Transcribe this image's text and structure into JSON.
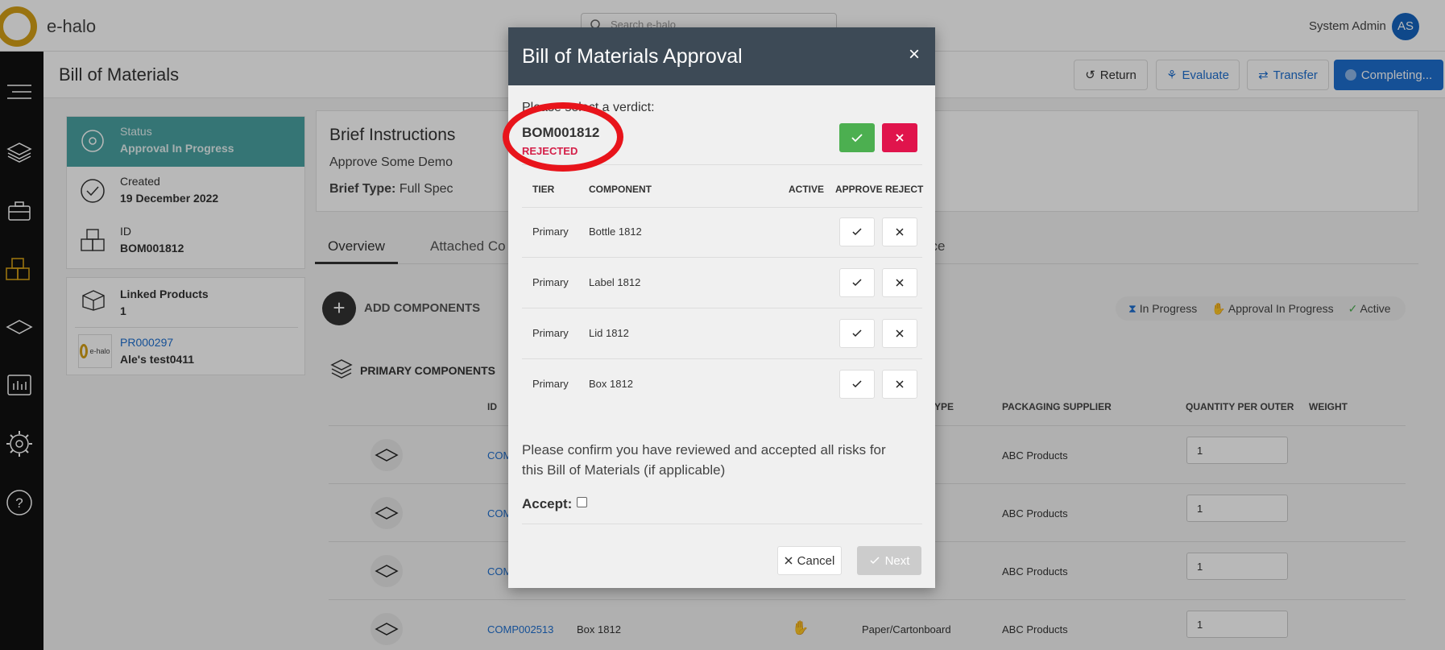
{
  "app": {
    "logo_text": "e-halo",
    "search_placeholder": "Search e-halo",
    "user_name": "System Admin",
    "user_initials": "AS"
  },
  "page": {
    "title": "Bill of Materials",
    "actions": [
      "Return",
      "Evaluate",
      "Transfer",
      "Completing..."
    ]
  },
  "info": {
    "status_label": "Status",
    "status_value": "Approval In Progress",
    "created_label": "Created",
    "created_value": "19 December 2022",
    "id_label": "ID",
    "id_value": "BOM001812",
    "linked_label": "Linked Products",
    "linked_count": "1",
    "linked_product_id": "PR000297",
    "linked_product_name": "Ale's test0411",
    "linked_logo_text": "e-halo"
  },
  "brief": {
    "title": "Brief Instructions",
    "text": "Approve Some Demo",
    "type_label": "Brief Type:",
    "type_value": "Full Spec"
  },
  "tabs": [
    "Overview",
    "Attached Co",
    "nce"
  ],
  "components": {
    "add_label": "ADD COMPONENTS",
    "section_title": "PRIMARY COMPONENTS",
    "legend": [
      "In Progress",
      "Approval In Progress",
      "Active"
    ],
    "headers": [
      "ID",
      "YPE",
      "PACKAGING SUPPLIER",
      "QUANTITY PER OUTER",
      "WEIGHT"
    ],
    "rows": [
      {
        "id": "COM",
        "name": "",
        "material": "",
        "supplier": "ABC Products",
        "qty": "1"
      },
      {
        "id": "COM",
        "name": "",
        "material": "",
        "supplier": "ABC Products",
        "qty": "1"
      },
      {
        "id": "COM",
        "name": "",
        "material": "",
        "supplier": "ABC Products",
        "qty": "1"
      },
      {
        "id": "COMP002513",
        "name": "Box 1812",
        "material": "Paper/Cartonboard",
        "supplier": "ABC Products",
        "qty": "1"
      }
    ]
  },
  "modal": {
    "title": "Bill of Materials Approval",
    "close": "×",
    "verdict_label": "Please select a verdict:",
    "bom_id": "BOM001812",
    "bom_status": "REJECTED",
    "headers": {
      "tier": "TIER",
      "component": "COMPONENT",
      "active": "ACTIVE",
      "approve": "APPROVE",
      "reject": "REJECT"
    },
    "rows": [
      {
        "tier": "Primary",
        "component": "Bottle 1812"
      },
      {
        "tier": "Primary",
        "component": "Label 1812"
      },
      {
        "tier": "Primary",
        "component": "Lid 1812"
      },
      {
        "tier": "Primary",
        "component": "Box 1812"
      }
    ],
    "confirm_text": "Please confirm you have reviewed and accepted all risks for this Bill of Materials (if applicable)",
    "accept_label": "Accept:",
    "cancel_label": "Cancel",
    "next_label": "Next"
  },
  "colors": {
    "accent": "#1e6fd0",
    "status_bg": "#4aa3a2",
    "approve": "#4caf50",
    "reject": "#e0144c",
    "highlight": "#e8141b"
  }
}
